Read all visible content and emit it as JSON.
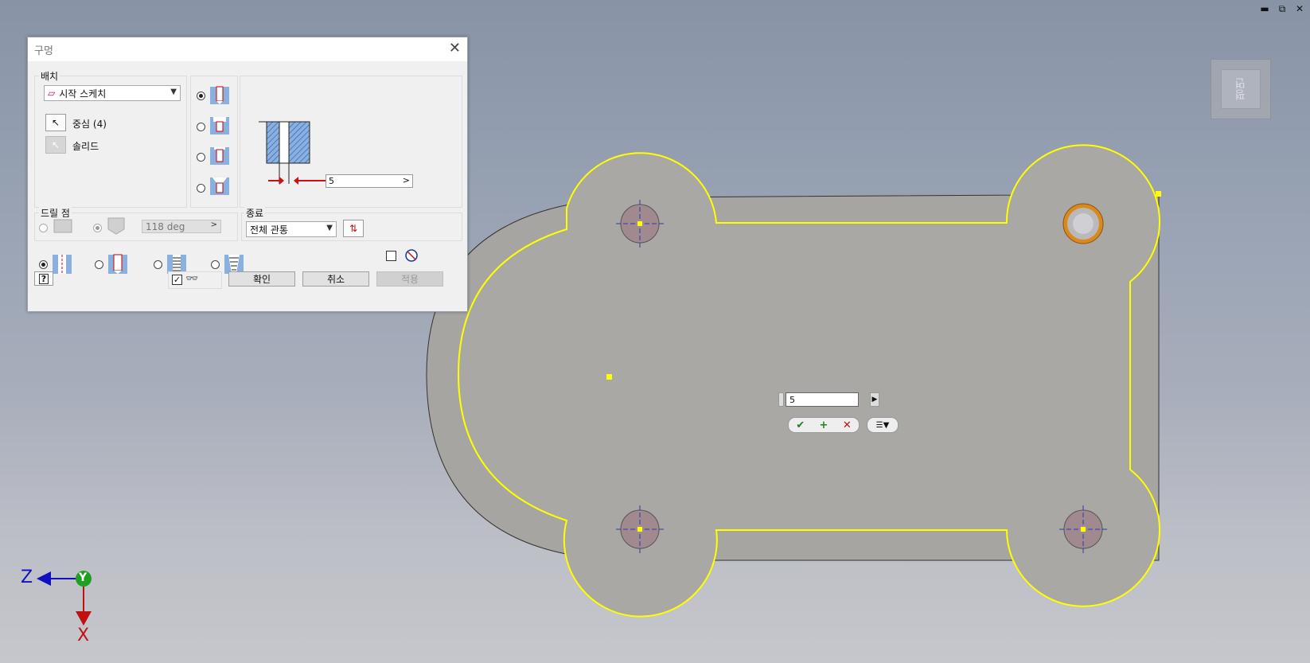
{
  "window_controls": {
    "minimize": "▬",
    "restore": "⧉",
    "close": "✕"
  },
  "viewcube": {
    "face_label": "평면"
  },
  "dialog": {
    "title": "구멍",
    "close_symbol": "✕",
    "placement": {
      "label": "배치",
      "combo_value": "시작 스케치",
      "center_label": "중심 (4)",
      "solid_label": "솔리드"
    },
    "diameter_value": "5",
    "drill_point": {
      "label": "드릴 점",
      "angle_value": "118 deg"
    },
    "termination": {
      "label": "종료",
      "combo_value": "전체 관통"
    },
    "buttons": {
      "ok": "확인",
      "cancel": "취소",
      "apply": "적용",
      "help": "?"
    }
  },
  "mini_toolbar": {
    "value": "5",
    "ok_symbol": "✔",
    "add_symbol": "+",
    "cancel_symbol": "✕"
  },
  "triad": {
    "z": "Z",
    "y": "Y",
    "x": "X"
  },
  "colors": {
    "part_fill": "#a9a8a5",
    "sketch_highlight": "#ffff00",
    "hole_fill": "#a08a90",
    "accent_orange": "#d98a1a"
  }
}
